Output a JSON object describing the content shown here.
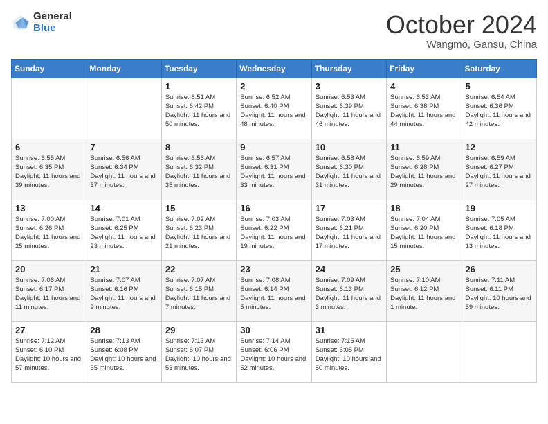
{
  "logo": {
    "general": "General",
    "blue": "Blue"
  },
  "title": "October 2024",
  "location": "Wangmo, Gansu, China",
  "days_header": [
    "Sunday",
    "Monday",
    "Tuesday",
    "Wednesday",
    "Thursday",
    "Friday",
    "Saturday"
  ],
  "weeks": [
    [
      {
        "num": "",
        "info": ""
      },
      {
        "num": "",
        "info": ""
      },
      {
        "num": "1",
        "info": "Sunrise: 6:51 AM\nSunset: 6:42 PM\nDaylight: 11 hours and 50 minutes."
      },
      {
        "num": "2",
        "info": "Sunrise: 6:52 AM\nSunset: 6:40 PM\nDaylight: 11 hours and 48 minutes."
      },
      {
        "num": "3",
        "info": "Sunrise: 6:53 AM\nSunset: 6:39 PM\nDaylight: 11 hours and 46 minutes."
      },
      {
        "num": "4",
        "info": "Sunrise: 6:53 AM\nSunset: 6:38 PM\nDaylight: 11 hours and 44 minutes."
      },
      {
        "num": "5",
        "info": "Sunrise: 6:54 AM\nSunset: 6:36 PM\nDaylight: 11 hours and 42 minutes."
      }
    ],
    [
      {
        "num": "6",
        "info": "Sunrise: 6:55 AM\nSunset: 6:35 PM\nDaylight: 11 hours and 39 minutes."
      },
      {
        "num": "7",
        "info": "Sunrise: 6:56 AM\nSunset: 6:34 PM\nDaylight: 11 hours and 37 minutes."
      },
      {
        "num": "8",
        "info": "Sunrise: 6:56 AM\nSunset: 6:32 PM\nDaylight: 11 hours and 35 minutes."
      },
      {
        "num": "9",
        "info": "Sunrise: 6:57 AM\nSunset: 6:31 PM\nDaylight: 11 hours and 33 minutes."
      },
      {
        "num": "10",
        "info": "Sunrise: 6:58 AM\nSunset: 6:30 PM\nDaylight: 11 hours and 31 minutes."
      },
      {
        "num": "11",
        "info": "Sunrise: 6:59 AM\nSunset: 6:28 PM\nDaylight: 11 hours and 29 minutes."
      },
      {
        "num": "12",
        "info": "Sunrise: 6:59 AM\nSunset: 6:27 PM\nDaylight: 11 hours and 27 minutes."
      }
    ],
    [
      {
        "num": "13",
        "info": "Sunrise: 7:00 AM\nSunset: 6:26 PM\nDaylight: 11 hours and 25 minutes."
      },
      {
        "num": "14",
        "info": "Sunrise: 7:01 AM\nSunset: 6:25 PM\nDaylight: 11 hours and 23 minutes."
      },
      {
        "num": "15",
        "info": "Sunrise: 7:02 AM\nSunset: 6:23 PM\nDaylight: 11 hours and 21 minutes."
      },
      {
        "num": "16",
        "info": "Sunrise: 7:03 AM\nSunset: 6:22 PM\nDaylight: 11 hours and 19 minutes."
      },
      {
        "num": "17",
        "info": "Sunrise: 7:03 AM\nSunset: 6:21 PM\nDaylight: 11 hours and 17 minutes."
      },
      {
        "num": "18",
        "info": "Sunrise: 7:04 AM\nSunset: 6:20 PM\nDaylight: 11 hours and 15 minutes."
      },
      {
        "num": "19",
        "info": "Sunrise: 7:05 AM\nSunset: 6:18 PM\nDaylight: 11 hours and 13 minutes."
      }
    ],
    [
      {
        "num": "20",
        "info": "Sunrise: 7:06 AM\nSunset: 6:17 PM\nDaylight: 11 hours and 11 minutes."
      },
      {
        "num": "21",
        "info": "Sunrise: 7:07 AM\nSunset: 6:16 PM\nDaylight: 11 hours and 9 minutes."
      },
      {
        "num": "22",
        "info": "Sunrise: 7:07 AM\nSunset: 6:15 PM\nDaylight: 11 hours and 7 minutes."
      },
      {
        "num": "23",
        "info": "Sunrise: 7:08 AM\nSunset: 6:14 PM\nDaylight: 11 hours and 5 minutes."
      },
      {
        "num": "24",
        "info": "Sunrise: 7:09 AM\nSunset: 6:13 PM\nDaylight: 11 hours and 3 minutes."
      },
      {
        "num": "25",
        "info": "Sunrise: 7:10 AM\nSunset: 6:12 PM\nDaylight: 11 hours and 1 minute."
      },
      {
        "num": "26",
        "info": "Sunrise: 7:11 AM\nSunset: 6:11 PM\nDaylight: 10 hours and 59 minutes."
      }
    ],
    [
      {
        "num": "27",
        "info": "Sunrise: 7:12 AM\nSunset: 6:10 PM\nDaylight: 10 hours and 57 minutes."
      },
      {
        "num": "28",
        "info": "Sunrise: 7:13 AM\nSunset: 6:08 PM\nDaylight: 10 hours and 55 minutes."
      },
      {
        "num": "29",
        "info": "Sunrise: 7:13 AM\nSunset: 6:07 PM\nDaylight: 10 hours and 53 minutes."
      },
      {
        "num": "30",
        "info": "Sunrise: 7:14 AM\nSunset: 6:06 PM\nDaylight: 10 hours and 52 minutes."
      },
      {
        "num": "31",
        "info": "Sunrise: 7:15 AM\nSunset: 6:05 PM\nDaylight: 10 hours and 50 minutes."
      },
      {
        "num": "",
        "info": ""
      },
      {
        "num": "",
        "info": ""
      }
    ]
  ]
}
